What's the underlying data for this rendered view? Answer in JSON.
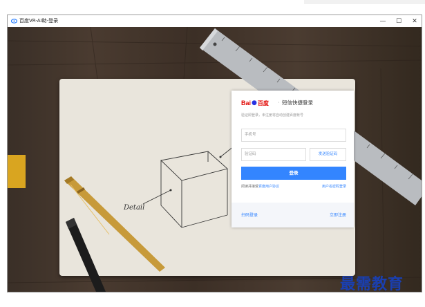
{
  "window": {
    "title": "百度VR-AI助-登录",
    "controls": {
      "minimize": "—",
      "maximize": "☐",
      "close": "✕"
    }
  },
  "background": {
    "sketch_label": "Detail"
  },
  "login_card": {
    "logo_bai": "Bai",
    "logo_baidu": "百度",
    "separator": "·",
    "title": "短信快捷登录",
    "subtitle": "验证即登录，未注册将自动创建百度帐号",
    "phone_placeholder": "手机号",
    "code_placeholder": "验证码",
    "send_code_label": "发送验证码",
    "login_label": "登录",
    "agreement_prefix": "阅读并接受",
    "agreement_link": "百度用户协议",
    "password_login": "用户名密码登录",
    "scan_login": "扫码登录",
    "register": "立即注册"
  },
  "watermark": "最需教育",
  "colors": {
    "accent": "#3385ff",
    "baidu_red": "#e10602",
    "baidu_blue": "#2932e1",
    "watermark": "#1a3fb0"
  }
}
